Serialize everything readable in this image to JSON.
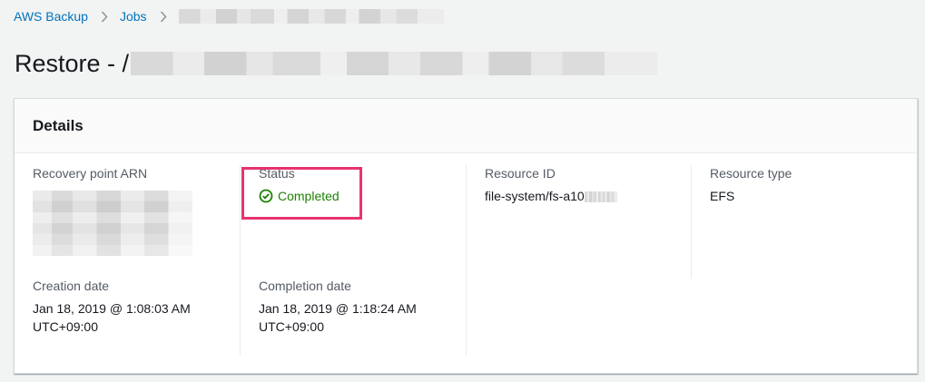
{
  "breadcrumb": {
    "items": [
      {
        "label": "AWS Backup"
      },
      {
        "label": "Jobs"
      }
    ]
  },
  "page": {
    "title_prefix": "Restore - /"
  },
  "details": {
    "header": "Details",
    "fields": {
      "recovery_point_arn": {
        "label": "Recovery point ARN"
      },
      "status": {
        "label": "Status",
        "value": "Completed"
      },
      "resource_id": {
        "label": "Resource ID",
        "value": "file-system/fs-a10"
      },
      "resource_type": {
        "label": "Resource type",
        "value": "EFS"
      },
      "creation_date": {
        "label": "Creation date",
        "value_line1": "Jan 18, 2019 @ 1:08:03 AM",
        "value_line2": "UTC+09:00"
      },
      "completion_date": {
        "label": "Completion date",
        "value_line1": "Jan 18, 2019 @ 1:18:24 AM",
        "value_line2": "UTC+09:00"
      }
    }
  },
  "colors": {
    "link": "#0073bb",
    "success": "#1d8102",
    "highlight": "#e8336e"
  },
  "icons": {
    "breadcrumb_separator": "chevron-right-icon",
    "status": "check-circle-icon"
  }
}
